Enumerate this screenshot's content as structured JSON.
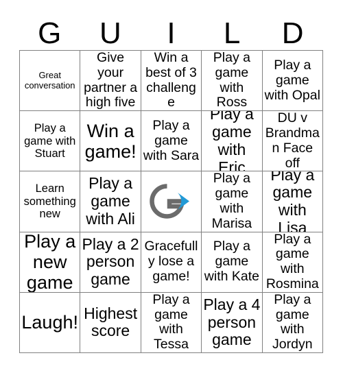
{
  "card": {
    "header_letters": [
      "G",
      "U",
      "I",
      "L",
      "D"
    ],
    "free_space": {
      "logo_name": "guild-logo",
      "letter": "G",
      "g_color": "#6b6b6b",
      "arrow_color": "#229ad6"
    },
    "rows": [
      [
        {
          "text": "Great conversation",
          "size": "xs"
        },
        {
          "text": "Give your partner a high five",
          "size": "m"
        },
        {
          "text": "Win a best of 3 challenge",
          "size": "m"
        },
        {
          "text": "Play a game with Ross",
          "size": "m"
        },
        {
          "text": "Play a game with Opal",
          "size": "m"
        }
      ],
      [
        {
          "text": "Play a game with Stuart",
          "size": "s"
        },
        {
          "text": "Win a game!",
          "size": "xl"
        },
        {
          "text": "Play a game with Sara",
          "size": "m"
        },
        {
          "text": "Play a game with Eric",
          "size": "l"
        },
        {
          "text": "DU v Brandman Face off",
          "size": "m"
        }
      ],
      [
        {
          "text": "Learn something new",
          "size": "s"
        },
        {
          "text": "Play a game with Ali",
          "size": "l"
        },
        {
          "text": "",
          "size": "m",
          "free": true
        },
        {
          "text": "Play a game with Marisa",
          "size": "m"
        },
        {
          "text": "Play a game with Lisa",
          "size": "l"
        }
      ],
      [
        {
          "text": "Play a new game",
          "size": "xl"
        },
        {
          "text": "Play a 2 person game",
          "size": "l"
        },
        {
          "text": "Gracefully lose a game!",
          "size": "m"
        },
        {
          "text": "Play a game with Kate",
          "size": "m"
        },
        {
          "text": "Play a game with Rosmina",
          "size": "m"
        }
      ],
      [
        {
          "text": "Laugh!",
          "size": "xl"
        },
        {
          "text": "Highest score",
          "size": "l"
        },
        {
          "text": "Play a game with Tessa",
          "size": "m"
        },
        {
          "text": "Play a 4 person game",
          "size": "l"
        },
        {
          "text": "Play a game with Jordyn",
          "size": "m"
        }
      ]
    ]
  }
}
